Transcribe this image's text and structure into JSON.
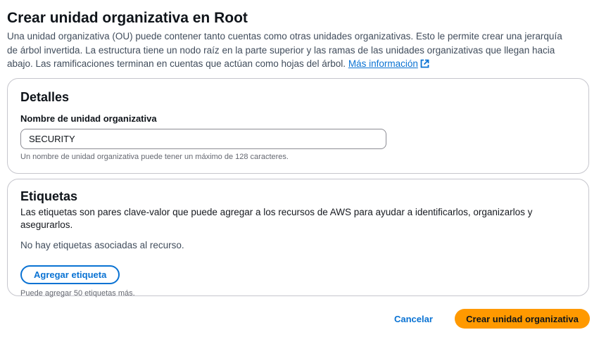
{
  "page": {
    "title": "Crear unidad organizativa en Root",
    "description": "Una unidad organizativa (OU) puede contener tanto cuentas como otras unidades organizativas. Esto le permite crear una jerarquía de árbol invertida. La estructura tiene un nodo raíz en la parte superior y las ramas de las unidades organizativas que llegan hacia abajo. Las ramificaciones terminan en cuentas que actúan como hojas del árbol.",
    "more_info_link": "Más información",
    "more_info_icon": "external-link-icon"
  },
  "details": {
    "heading": "Detalles",
    "name_label": "Nombre de unidad organizativa",
    "name_value": "SECURITY",
    "name_hint": "Un nombre de unidad organizativa puede tener un máximo de 128 caracteres."
  },
  "tags": {
    "heading": "Etiquetas",
    "description": "Las etiquetas son pares clave-valor que puede agregar a los recursos de AWS para ayudar a identificarlos, organizarlos y asegurarlos.",
    "empty_text": "No hay etiquetas asociadas al recurso.",
    "add_button": "Agregar etiqueta",
    "remaining_hint": "Puede agregar 50 etiquetas más."
  },
  "footer": {
    "cancel_label": "Cancelar",
    "create_label": "Crear unidad organizativa"
  },
  "colors": {
    "link": "#0972d3",
    "primary_button": "#ff9900",
    "panel_border": "#c6c6cd"
  }
}
